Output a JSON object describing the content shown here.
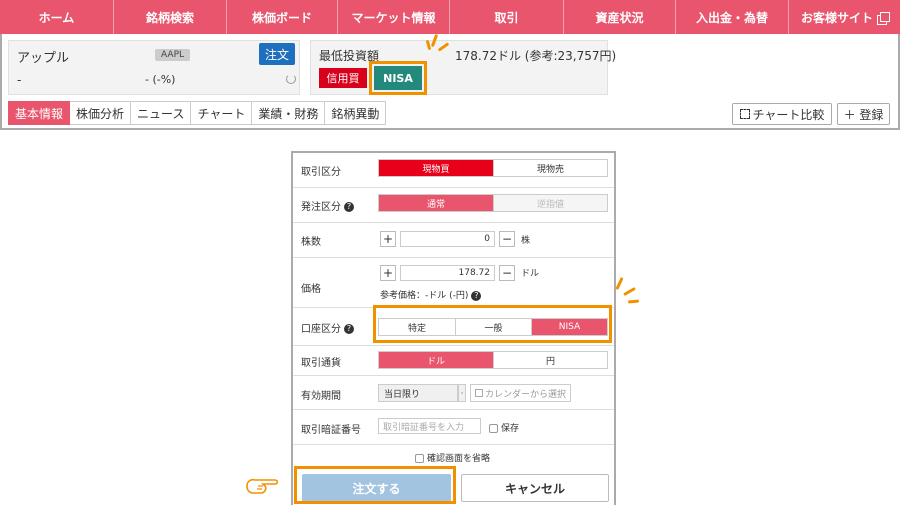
{
  "topnav": {
    "items": [
      "ホーム",
      "銘柄検索",
      "株価ボード",
      "マーケット情報",
      "取引",
      "資産状況",
      "入出金・為替",
      "お客様サイト"
    ]
  },
  "stock": {
    "name": "アップル",
    "ticker": "AAPL",
    "order_label": "注文",
    "price": "-",
    "change": "- (-%)"
  },
  "invest": {
    "label": "最低投資額",
    "amount": "178.72ドル (参考:23,757円)",
    "credit_label": "信用買",
    "nisa_label": "NISA"
  },
  "subtabs": [
    "基本情報",
    "株価分析",
    "ニュース",
    "チャート",
    "業績・財務",
    "銘柄異動"
  ],
  "actions": {
    "compare": "チャート比較",
    "register": "＋ 登録"
  },
  "form": {
    "trade_type": {
      "label": "取引区分",
      "options": [
        "現物買",
        "現物売"
      ],
      "selected": 0
    },
    "order_type": {
      "label": "発注区分",
      "options": [
        "通常",
        "逆指値"
      ],
      "selected": 0
    },
    "qty": {
      "label": "株数",
      "value": "0",
      "unit": "株",
      "plus": "+",
      "minus": "−"
    },
    "price": {
      "label": "価格",
      "value": "178.72",
      "unit": "ドル",
      "ref": "参考価格：-ドル (-円)",
      "plus": "+",
      "minus": "−"
    },
    "account": {
      "label": "口座区分",
      "options": [
        "特定",
        "一般",
        "NISA"
      ],
      "selected": 2
    },
    "currency": {
      "label": "取引通貨",
      "options": [
        "ドル",
        "円"
      ],
      "selected": 0
    },
    "expiry": {
      "label": "有効期間",
      "value": "当日限り",
      "calendar": "カレンダーから選択"
    },
    "pin": {
      "label": "取引暗証番号",
      "placeholder": "取引暗証番号を入力",
      "save": "保存"
    },
    "skip_confirm": "確認画面を省略",
    "submit": "注文する",
    "cancel": "キャンセル"
  },
  "colors": {
    "nav": "#e8556c",
    "highlight": "#f29100",
    "nisa": "#22897c",
    "order": "#1f6fbf"
  }
}
